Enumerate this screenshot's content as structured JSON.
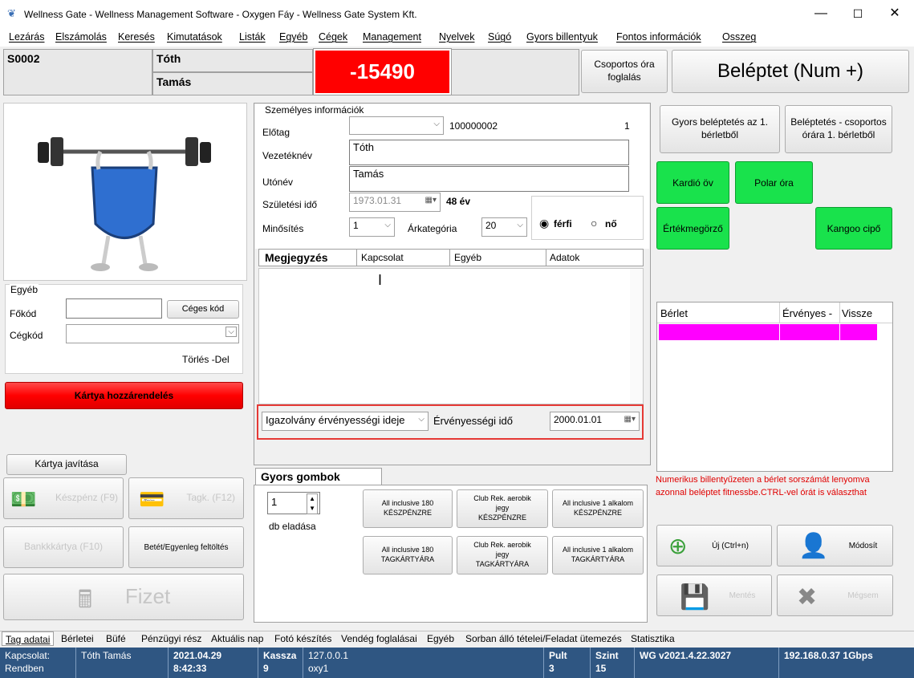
{
  "window": {
    "title": "Wellness Gate - Wellness Management Software - Oxygen Fáy - Wellness Gate System Kft.",
    "minimize": "—",
    "maximize": "☐",
    "close": "✕"
  },
  "menu": [
    "Lezárás",
    "Elszámolás",
    "Keresés",
    "Kimutatások",
    "Listák",
    "Egyéb",
    "Cégek",
    "Management",
    "Nyelvek",
    "Súgó",
    "Gyors billentyuk",
    "Fontos információk",
    "Osszeg"
  ],
  "header": {
    "member_id": "S0002",
    "last_name": "Tóth",
    "first_name": "Tamás",
    "balance": "-15490",
    "group_booking": "Csoportos óra foglalás",
    "checkin": "Beléptet (Num +)"
  },
  "left": {
    "egyeb_title": "Egyéb",
    "fokod_label": "Főkód",
    "fokod_value": "",
    "ceges_kod_button": "Céges kód",
    "cegkod_label": "Cégkód",
    "cegkod_value": "",
    "torles_label": "Törlés -Del",
    "card_assign": "Kártya hozzárendelés",
    "card_repair": "Kártya javítása",
    "cash": "Készpénz (F9)",
    "member_card": "Tagk. (F12)",
    "bank_card": "Bankkkártya (F10)",
    "deposit": "Betét/Egyenleg feltöltés",
    "pay": "Fizet"
  },
  "personal": {
    "title": "Személyes információk",
    "prefix_label": "Előtag",
    "prefix_value": "",
    "code": "100000002",
    "code_count": "1",
    "surname_label": "Vezetéknév",
    "surname_value": "Tóth",
    "firstname_label": "Utónév",
    "firstname_value": "Tamás",
    "birth_label": "Születési idő",
    "birth_value": "1973.01.31",
    "age": "48 év",
    "rating_label": "Minősítés",
    "rating_value": "1",
    "price_cat_label": "Árkategória",
    "price_cat_value": "20",
    "male": "férfi",
    "female": "nő"
  },
  "notes": {
    "tabs": [
      "Megjegyzés",
      "Kapcsolat",
      "Egyéb",
      "Adatok"
    ],
    "id_validity": "Igazolvány érvényességi ideje",
    "validity_label": "Érvényességi idő",
    "validity_value": "2000.01.01"
  },
  "quick": {
    "title": "Gyors gombok",
    "qty": "1",
    "qty_label": "db eladása",
    "buttons": [
      "All inclusive 180\nKÉSZPÉNZRE",
      "Club Rek. aerobik\njegy\nKÉSZPÉNZRE",
      "All inclusive 1 alkalom\nKÉSZPÉNZRE",
      "All inclusive 180\nTAGKÁRTYÁRA",
      "Club Rek. aerobik\njegy\nTAGKÁRTYÁRA",
      "All inclusive 1 alkalom\nTAGKÁRTYÁRA"
    ]
  },
  "right": {
    "fast_checkin": "Gyors beléptetés  az 1. bérletből",
    "group_checkin": "Beléptetés - csoportos órára 1. bérletből",
    "cardio": "Kardió öv",
    "polar": "Polar óra",
    "locker": "Értékmegörző",
    "kangoo": "Kangoo cipő",
    "table_headers": [
      "Bérlet",
      "Érvényes -",
      "Vissze"
    ],
    "hint": "Numerikus billentyűzeten a bérlet sorszámát lenyomva azonnal beléptet fitnessbe.CTRL-vel órát is választhat",
    "new": "Új (Ctrl+n)",
    "edit": "Módosít",
    "save": "Mentés",
    "cancel": "Mégsem"
  },
  "bottom_tabs": [
    "Tag adatai",
    "Bérletei",
    "Büfé",
    "Pénzügyi rész",
    "Aktuális nap",
    "Fotó készítés",
    "Vendég foglalásai",
    "Egyéb",
    "Sorban álló tételei/Feladat ütemezés",
    "Statisztika"
  ],
  "status": {
    "conn_label": "Kapcsolat:",
    "conn_value": "Rendben",
    "user": "Tóth Tamás",
    "date": "2021.04.29",
    "time": "8:42:33",
    "kassza_label": "Kassza",
    "kassza_value": "9",
    "ip": "127.0.0.1",
    "host": "oxy1",
    "pult_label": "Pult",
    "pult_value": "3",
    "szint_label": "Szint",
    "szint_value": "15",
    "version": "WG v2021.4.22.3027",
    "network": "192.168.0.37 1Gbps"
  },
  "colors": {
    "balance_bg": "#ff0000",
    "green": "#19e24c",
    "magenta": "#ff00ff",
    "status_bg": "#2f5682",
    "highlight": "#e53935"
  }
}
